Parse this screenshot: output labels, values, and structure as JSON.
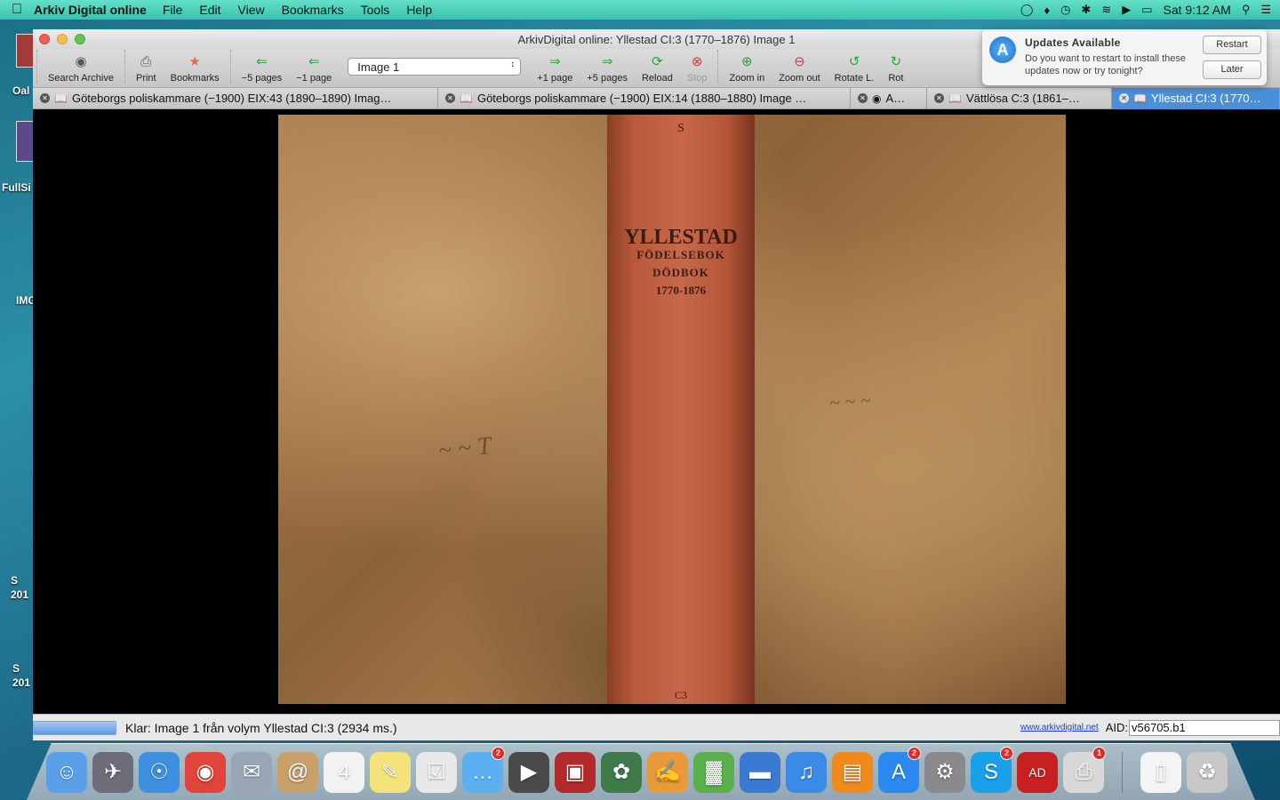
{
  "menubar": {
    "app_name": "Arkiv Digital online",
    "menus": [
      "File",
      "Edit",
      "View",
      "Bookmarks",
      "Tools",
      "Help"
    ],
    "clock": "Sat 9:12 AM"
  },
  "desktop_labels": [
    "Oal",
    "FullSi",
    "IMG",
    "S\n201",
    "S\n201"
  ],
  "window": {
    "title": "ArkivDigital online: Yllestad CI:3 (1770–1876)  Image 1"
  },
  "toolbar": {
    "search_archive": "Search Archive",
    "print": "Print",
    "bookmarks": "Bookmarks",
    "minus5": "−5 pages",
    "minus1": "−1 page",
    "image_select": "Image 1",
    "plus1": "+1 page",
    "plus5": "+5 pages",
    "reload": "Reload",
    "stop": "Stop",
    "zoom_in": "Zoom in",
    "zoom_out": "Zoom out",
    "rotate_l": "Rotate L.",
    "rotate_r": "Rot"
  },
  "tabs": [
    {
      "label": "Göteborgs poliskammare (−1900) EIX:43 (1890–1890)  Imag…",
      "active": false
    },
    {
      "label": "Göteborgs poliskammare (−1900) EIX:14 (1880–1880)  Image …",
      "active": false
    },
    {
      "label": "A…",
      "active": false
    },
    {
      "label": "Vättlösa C:3 (1861–…",
      "active": false
    },
    {
      "label": "Yllestad CI:3 (1770…",
      "active": true
    }
  ],
  "book": {
    "spine_top": "S",
    "spine_title": "YLLESTAD",
    "spine_line2": "FÖDELSEBOK",
    "spine_line3": "DÖDBOK",
    "spine_years": "1770-1876",
    "spine_bottom": "C3"
  },
  "status": {
    "text": "Klar:  Image 1 från volym Yllestad CI:3 (2934 ms.)",
    "link": "www.arkivdigital.net",
    "aid_label": "AID:",
    "aid_value": "v56705.b1"
  },
  "notification": {
    "title": "Updates Available",
    "text": "Do you want to restart to install these updates now or try tonight?",
    "restart": "Restart",
    "later": "Later"
  },
  "dock": {
    "icons": [
      {
        "name": "finder-icon",
        "color": "#5aa0e8",
        "glyph": "☺"
      },
      {
        "name": "launchpad-icon",
        "color": "#6d6d7a",
        "glyph": "✈"
      },
      {
        "name": "safari-icon",
        "color": "#3d8fe0",
        "glyph": "☉"
      },
      {
        "name": "chrome-icon",
        "color": "#e0443a",
        "glyph": "◉"
      },
      {
        "name": "mail-icon",
        "color": "#9aa6b5",
        "glyph": "✉"
      },
      {
        "name": "contacts-icon",
        "color": "#c9a06a",
        "glyph": "@"
      },
      {
        "name": "calendar-icon",
        "color": "#f2f2f2",
        "glyph": "4"
      },
      {
        "name": "notes-icon",
        "color": "#f4e27a",
        "glyph": "✎"
      },
      {
        "name": "reminders-icon",
        "color": "#e8e8e8",
        "glyph": "☑"
      },
      {
        "name": "messages-icon",
        "color": "#5ab0f0",
        "glyph": "…",
        "badge": "2"
      },
      {
        "name": "facetime-icon",
        "color": "#4a4a4a",
        "glyph": "▶"
      },
      {
        "name": "photo-booth-icon",
        "color": "#b22a2a",
        "glyph": "▣"
      },
      {
        "name": "iphoto-icon",
        "color": "#3e7a4a",
        "glyph": "✿"
      },
      {
        "name": "pages-icon",
        "color": "#e89a3a",
        "glyph": "✍"
      },
      {
        "name": "numbers-icon",
        "color": "#5ab04a",
        "glyph": "▓"
      },
      {
        "name": "keynote-icon",
        "color": "#3a7ad0",
        "glyph": "▬"
      },
      {
        "name": "itunes-icon",
        "color": "#3a8ae8",
        "glyph": "♫"
      },
      {
        "name": "ibooks-icon",
        "color": "#f08a1a",
        "glyph": "▤"
      },
      {
        "name": "app-store-icon",
        "color": "#2a8af0",
        "glyph": "A",
        "badge": "2"
      },
      {
        "name": "system-preferences-icon",
        "color": "#8a8a8a",
        "glyph": "⚙"
      },
      {
        "name": "skype-icon",
        "color": "#1aa0e8",
        "glyph": "S",
        "badge": "2"
      },
      {
        "name": "arkivdigital-icon",
        "color": "#c82020",
        "glyph": "AD"
      },
      {
        "name": "printer-icon",
        "color": "#d8d8d8",
        "glyph": "⎙",
        "badge": "1"
      }
    ],
    "right_icons": [
      {
        "name": "document-icon",
        "color": "#f4f4f4",
        "glyph": "▯"
      },
      {
        "name": "trash-icon",
        "color": "#c8c8c8",
        "glyph": "♻"
      }
    ]
  }
}
